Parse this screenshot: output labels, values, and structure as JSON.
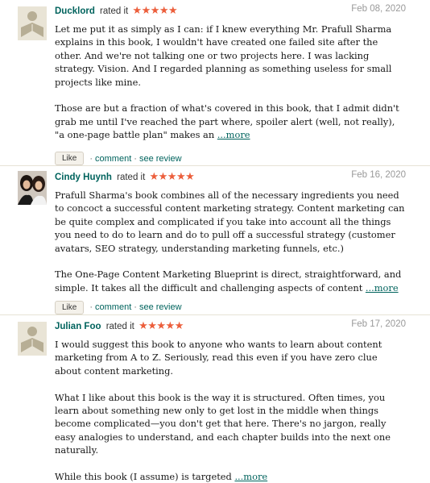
{
  "reviews": [
    {
      "user": "Ducklord",
      "rated": "rated it",
      "stars": "★★★★★",
      "date": "Feb 08, 2020",
      "paragraphs": [
        "Let me put it as simply as I can: if I knew everything Mr. Prafull Sharma explains in this book, I wouldn't have created one failed site after the other. And we're not talking one or two projects here. I was lacking strategy. Vision. And I regarded planning as something useless for small projects like mine.",
        "Those are but a fraction of what's covered in this book, that I admit didn't grab me until I've reached the part where, spoiler alert (well, not really), \"a one-page battle plan\" makes an"
      ],
      "more": "...more",
      "like": "Like",
      "comment": "comment",
      "see_review": "see review"
    },
    {
      "user": "Cindy Huynh",
      "rated": "rated it",
      "stars": "★★★★★",
      "date": "Feb 16, 2020",
      "paragraphs": [
        "Prafull Sharma's book combines all of the necessary ingredients you need to concoct a successful content marketing strategy. Content marketing can be quite complex and complicated if you take into account all the things you need to do to learn and do to pull off a successful strategy (customer avatars, SEO strategy, understanding marketing funnels, etc.)",
        "The One-Page Content Marketing Blueprint is direct, straightforward, and simple. It takes all the difficult and challenging aspects of content"
      ],
      "more": "...more",
      "like": "Like",
      "comment": "comment",
      "see_review": "see review"
    },
    {
      "user": "Julian Foo",
      "rated": "rated it",
      "stars": "★★★★★",
      "date": "Feb 17, 2020",
      "paragraphs": [
        "I would suggest this book to anyone who wants to learn about content marketing from A to Z. Seriously, read this even if you have zero clue about content marketing.",
        "What I like about this book is the way it is structured. Often times, you learn about something new only to get lost in the middle when things become complicated—you don't get that here. There's no jargon, really easy analogies to understand, and each chapter builds into the next one naturally.",
        "While this book (I assume) is targeted"
      ],
      "more": "...more"
    }
  ],
  "separator": "·",
  "colors": {
    "link": "#00635d",
    "stars": "#ec5e3b",
    "date": "#999999"
  },
  "icons": {
    "default_avatar": "person-reading-icon"
  }
}
